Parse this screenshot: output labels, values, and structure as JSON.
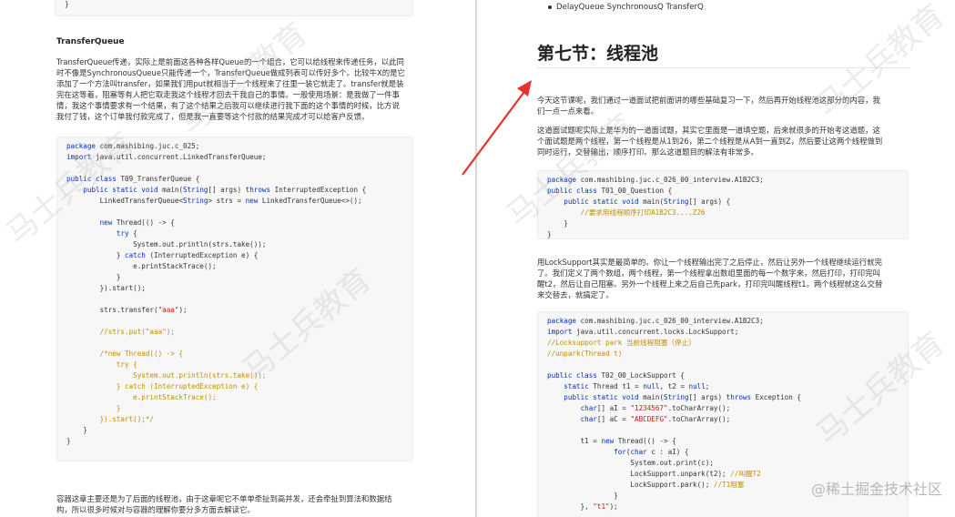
{
  "left": {
    "code_top": [
      [
        [
          "}",
          ""
        ]
      ]
    ],
    "section_title": "TransferQueue",
    "intro_lines": [
      "TransferQueue传递，实际上是前面这各种各样Queue的一个组合，它可以给线程来传递任务，以此同",
      "时不像是SynchronousQueue只能传递一个，TransferQueue做成列表可以传好多个。比较牛X的是它",
      "添加了一个方法叫transfer，如果我们用put就相当于一个线程来了往里一装它就走了。transfer就是装",
      "完在这等着，阻塞等有人把它取走我这个线程才回去干我自己的事情。一般使用场景：是我做了一件事",
      "情，我这个事情要求有一个结果，有了这个结果之后我可以继续进行我下面的这个事情的时候，比方说",
      "我付了钱，这个订单我付款完成了，但是我一直要等这个付款的结果完成才可以给客户反馈。"
    ],
    "code_main": [
      [
        [
          "package ",
          "kw"
        ],
        [
          "com.mashibing.juc.c_025;",
          ""
        ]
      ],
      [
        [
          "import ",
          "kw"
        ],
        [
          "java.util.concurrent.LinkedTransferQueue;",
          ""
        ]
      ],
      [
        [
          "",
          ""
        ]
      ],
      [
        [
          "public class ",
          "kw"
        ],
        [
          "T09_TransferQueue {",
          ""
        ]
      ],
      [
        [
          "    ",
          ""
        ],
        [
          "public static void ",
          "kw"
        ],
        [
          "main(",
          ""
        ],
        [
          "String",
          "kw"
        ],
        [
          "[] args) ",
          ""
        ],
        [
          "throws ",
          "kw"
        ],
        [
          "InterruptedException {",
          ""
        ]
      ],
      [
        [
          "        LinkedTransferQueue<",
          ""
        ],
        [
          "String",
          "kw"
        ],
        [
          "> strs = ",
          ""
        ],
        [
          "new ",
          "kw"
        ],
        [
          "LinkedTransferQueue<>();",
          ""
        ]
      ],
      [
        [
          "",
          ""
        ]
      ],
      [
        [
          "        ",
          ""
        ],
        [
          "new ",
          "kw"
        ],
        [
          "Thread(() -> {",
          ""
        ]
      ],
      [
        [
          "            ",
          ""
        ],
        [
          "try ",
          "kw"
        ],
        [
          "{",
          ""
        ]
      ],
      [
        [
          "                System.out.println(strs.take());",
          ""
        ]
      ],
      [
        [
          "            } ",
          ""
        ],
        [
          "catch ",
          "kw"
        ],
        [
          "(InterruptedException e) {",
          ""
        ]
      ],
      [
        [
          "                e.printStackTrace();",
          ""
        ]
      ],
      [
        [
          "            }",
          ""
        ]
      ],
      [
        [
          "        }).start();",
          ""
        ]
      ],
      [
        [
          "",
          ""
        ]
      ],
      [
        [
          "        strs.transfer(",
          ""
        ],
        [
          "\"aaa\"",
          "str"
        ],
        [
          ");",
          ""
        ]
      ],
      [
        [
          "",
          ""
        ]
      ],
      [
        [
          "        //strs.put(\"aaa\");",
          "cm"
        ]
      ],
      [
        [
          "",
          ""
        ]
      ],
      [
        [
          "        /*new Thread(() -> {",
          "cm"
        ]
      ],
      [
        [
          "            try {",
          "cm"
        ]
      ],
      [
        [
          "                System.out.println(strs.take());",
          "cm"
        ]
      ],
      [
        [
          "            } catch (InterruptedException e) {",
          "cm"
        ]
      ],
      [
        [
          "                e.printStackTrace();",
          "cm"
        ]
      ],
      [
        [
          "            }",
          "cm"
        ]
      ],
      [
        [
          "        }).start();*/",
          "cm"
        ]
      ],
      [
        [
          "    }",
          ""
        ]
      ],
      [
        [
          "}",
          ""
        ]
      ]
    ],
    "outro_lines": [
      "容器这章主要还是为了后面的线程池，由于这章呢它不单单牵扯到高并发，还会牵扯到算法和数据结",
      "构，所以很多时候对与容器的理解你要分多方面去解读它。"
    ]
  },
  "right": {
    "bullet_text": "DelayQueue  SynchronousQ  TransferQ",
    "chapter_title": "第七节：线程池",
    "para1_lines": [
      "今天这节课呢，我们通过一道面试把前面讲的哪些基础复习一下，然后再开始线程池这部分的内容，我",
      "们一点一点来看。"
    ],
    "para2_lines": [
      "这道面试题呢实际上是华为的一道面试题，其实它里面是一道填空题，后来就很多的开始考这道题，这",
      "个面试题是两个线程，第一个线程是从1到26，第二个线程是从A到一直到Z，然后要让这两个线程做到",
      "同时运行，交替输出，顺序打印。那么这道题目的解法有非常多。"
    ],
    "code1": [
      [
        [
          "package ",
          "kw"
        ],
        [
          "com.mashibing.juc.c_026_00_interview.A1B2C3;",
          ""
        ]
      ],
      [
        [
          "public class ",
          "kw"
        ],
        [
          "T01_00_Question {",
          ""
        ]
      ],
      [
        [
          "    ",
          ""
        ],
        [
          "public static void ",
          "kw"
        ],
        [
          "main(",
          ""
        ],
        [
          "String",
          "kw"
        ],
        [
          "[] args) {",
          ""
        ]
      ],
      [
        [
          "        //要求用线程顺序打印A1B2C3....Z26",
          "cm"
        ]
      ],
      [
        [
          "    }",
          ""
        ]
      ],
      [
        [
          "}",
          ""
        ]
      ]
    ],
    "para3_lines": [
      "用LockSupport其实是最简单的。你让一个线程输出完了之后停止，然后让另外一个线程继续运行就完",
      "了。我们定义了两个数组，两个线程，第一个线程拿出数组里面的每一个数字来，然后打印，打印完叫",
      "醒t2，然后让自己阻塞。另外一个线程上来之后自己先park，打印完叫醒线程t1。两个线程就这么交替",
      "来交替去，就搞定了。"
    ],
    "code2": [
      [
        [
          "package ",
          "kw"
        ],
        [
          "com.mashibing.juc.c_026_00_interview.A1B2C3;",
          ""
        ]
      ],
      [
        [
          "import ",
          "kw"
        ],
        [
          "java.util.concurrent.locks.LockSupport;",
          ""
        ]
      ],
      [
        [
          "//Locksupport park 当前线程阻塞（停止）",
          "cm"
        ]
      ],
      [
        [
          "//unpark(Thread t)",
          "cm"
        ]
      ],
      [
        [
          "",
          ""
        ]
      ],
      [
        [
          "public class ",
          "kw"
        ],
        [
          "T02_00_LockSupport {",
          ""
        ]
      ],
      [
        [
          "    ",
          ""
        ],
        [
          "static ",
          "kw"
        ],
        [
          "Thread t1 = ",
          ""
        ],
        [
          "null",
          "kw"
        ],
        [
          ", t2 = ",
          ""
        ],
        [
          "null",
          "kw"
        ],
        [
          ";",
          ""
        ]
      ],
      [
        [
          "    ",
          ""
        ],
        [
          "public static void ",
          "kw"
        ],
        [
          "main(",
          ""
        ],
        [
          "String",
          "kw"
        ],
        [
          "[] args) ",
          ""
        ],
        [
          "throws ",
          "kw"
        ],
        [
          "Exception {",
          ""
        ]
      ],
      [
        [
          "        ",
          ""
        ],
        [
          "char",
          "kw"
        ],
        [
          "[] aI = ",
          ""
        ],
        [
          "\"1234567\"",
          "str"
        ],
        [
          ".toCharArray();",
          ""
        ]
      ],
      [
        [
          "        ",
          ""
        ],
        [
          "char",
          "kw"
        ],
        [
          "[] aC = ",
          ""
        ],
        [
          "\"ABCDEFG\"",
          "str"
        ],
        [
          ".toCharArray();",
          ""
        ]
      ],
      [
        [
          "",
          ""
        ]
      ],
      [
        [
          "        t1 = ",
          ""
        ],
        [
          "new ",
          "kw"
        ],
        [
          "Thread(() -> {",
          ""
        ]
      ],
      [
        [
          "                ",
          ""
        ],
        [
          "for",
          "kw"
        ],
        [
          "(",
          ""
        ],
        [
          "char ",
          "kw"
        ],
        [
          "c : aI) {",
          ""
        ]
      ],
      [
        [
          "                    System.out.print(c);",
          ""
        ]
      ],
      [
        [
          "                    LockSupport.unpark(t2); ",
          ""
        ],
        [
          "//叫醒T2",
          "cm"
        ]
      ],
      [
        [
          "                    LockSupport.park(); ",
          ""
        ],
        [
          "//T1阻塞",
          "cm"
        ]
      ],
      [
        [
          "                }",
          ""
        ]
      ],
      [
        [
          "        }, ",
          ""
        ],
        [
          "\"t1\"",
          "str"
        ],
        [
          ");",
          ""
        ]
      ]
    ],
    "site_watermark": "@稀土掘金技术社区"
  },
  "watermark_text": "马士兵教育",
  "colors": {
    "keyword": "#0033b3",
    "string": "#c41a16",
    "comment": "#c28d00",
    "arrow": "#e5322d"
  }
}
